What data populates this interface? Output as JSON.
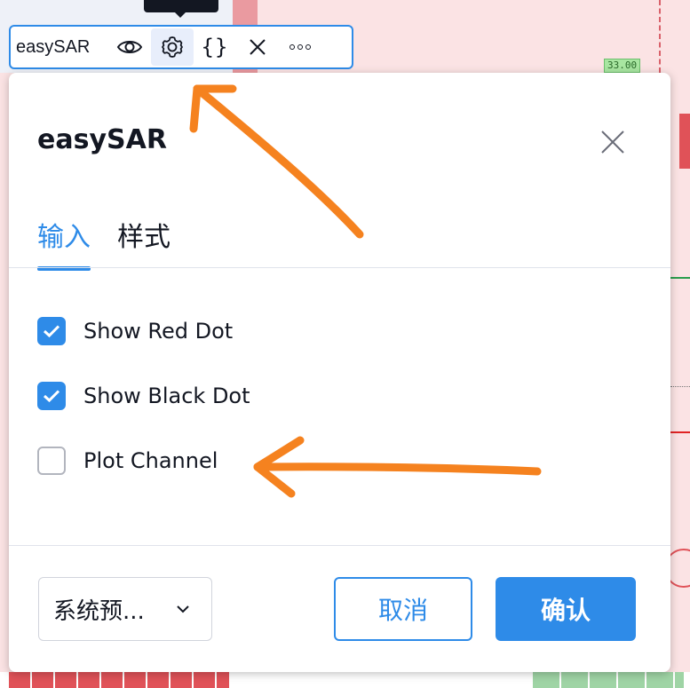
{
  "chart": {
    "price_label": "33.00"
  },
  "legend": {
    "indicator_name": "easySAR",
    "icons": [
      "eye-icon",
      "gear-icon",
      "braces-icon",
      "close-icon",
      "more-icon"
    ],
    "braces_text": "{}"
  },
  "dialog": {
    "title": "easySAR",
    "tabs": [
      {
        "label": "输入",
        "active": true
      },
      {
        "label": "样式",
        "active": false
      }
    ],
    "options": [
      {
        "label": "Show Red Dot",
        "checked": true
      },
      {
        "label": "Show Black Dot",
        "checked": true
      },
      {
        "label": "Plot Channel",
        "checked": false
      }
    ],
    "footer": {
      "preset_value": "系统预...",
      "cancel_label": "取消",
      "confirm_label": "确认"
    }
  },
  "colors": {
    "accent": "#2e8be8",
    "annotation": "#f5821f",
    "chart_background": "#fbe3e4",
    "text": "#131722"
  }
}
